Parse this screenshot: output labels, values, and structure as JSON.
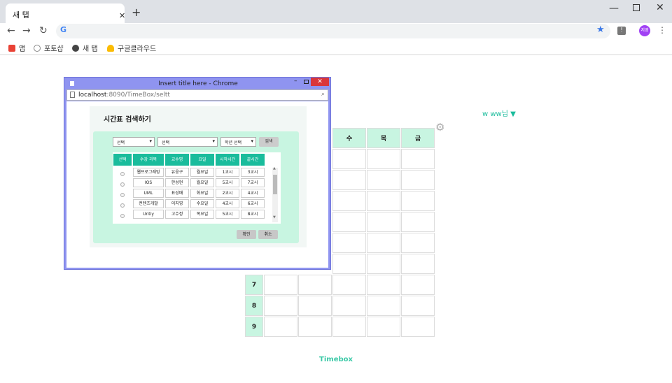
{
  "browser": {
    "tab_title": "새 탭",
    "bookmarks": [
      {
        "label": "앱",
        "color": "#e94235"
      },
      {
        "label": "포토샵",
        "color": "#888888"
      },
      {
        "label": "새 탭",
        "color": "#444444"
      },
      {
        "label": "구글클라우드",
        "color": "#fbbc04"
      }
    ],
    "avatar_text": "지영"
  },
  "page": {
    "user_menu": "w ww님",
    "footer": "Timebox",
    "timetable": {
      "days": [
        "수",
        "목",
        "금"
      ],
      "periods": [
        "7",
        "8",
        "9"
      ]
    }
  },
  "popup": {
    "title": "Insert title here - Chrome",
    "url_host": "localhost",
    "url_path": ":8090/TimeBox/seltt",
    "heading": "시간표 검색하기",
    "filter1": "선택",
    "filter2": "선택",
    "filter3": "학년 선택",
    "search_btn": "검색",
    "columns": [
      "선택",
      "수강 과목",
      "교수명",
      "요일",
      "시작시간",
      "끝시간"
    ],
    "rows": [
      [
        "웹프로그래밍",
        "유웅구",
        "월요일",
        "1교시",
        "3교시"
      ],
      [
        "IOS",
        "한성현",
        "월요일",
        "5교시",
        "7교시"
      ],
      [
        "UML",
        "표성배",
        "화요일",
        "2교시",
        "4교시"
      ],
      [
        "컨텐츠개발",
        "이지영",
        "수요일",
        "4교시",
        "6교시"
      ],
      [
        "Untiy",
        "고수정",
        "목요일",
        "5교시",
        "8교시"
      ]
    ],
    "confirm_btn": "확인",
    "cancel_btn": "취소"
  }
}
